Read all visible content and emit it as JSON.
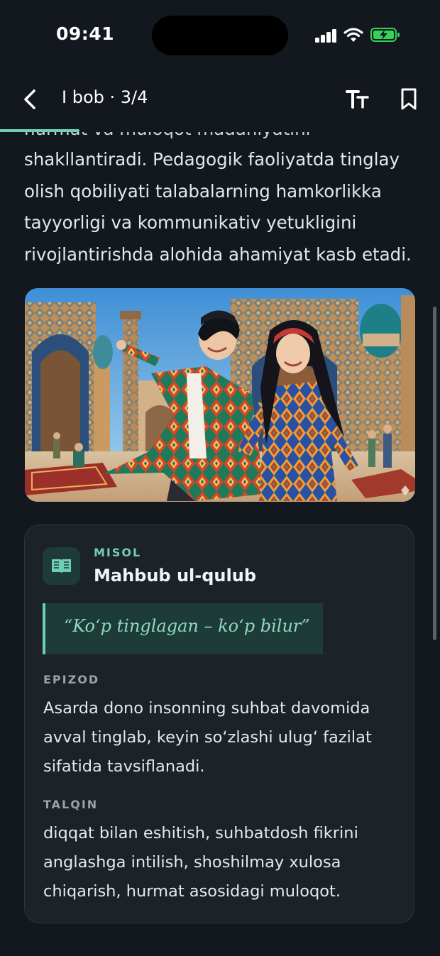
{
  "status_bar": {
    "time": "09:41"
  },
  "header": {
    "chapter": "I bob · 3/4",
    "reading_progress_percent": 18
  },
  "article": {
    "cut_line": "hurmat va muloqot madaniyatini",
    "paragraph": "shakllantiradi. Pedagogik faoliyatda tinglay olish qobiliyati talabalarning hamkorlikka tayyorligi va kommunikativ yetukligini rivojlantirishda alohida ahamiyat kasb etadi."
  },
  "example_card": {
    "kicker": "MISOL",
    "title": "Mahbub ul-qulub",
    "quote": "“Ko‘p tinglagan – ko‘p bilur”",
    "episode_label": "EPIZOD",
    "episode_text": "Asarda dono insonning suhbat davomida avval tinglab, keyin so‘zlashi ulug‘ fazilat sifatida tavsiflanadi.",
    "interpretation_label": "TALQIN",
    "interpretation_text": "diqqat bilan eshitish, suhbatdosh fikrini anglashga intilish, shoshilmay xulosa chiqarish, hurmat asosidagi muloqot."
  },
  "colors": {
    "background": "#12181d",
    "accent": "#6fcdb4",
    "card": "#1b2329",
    "battery_green": "#35d158"
  },
  "icons": [
    "back-chevron-icon",
    "text-size-icon",
    "bookmark-icon",
    "book-icon",
    "signal-icon",
    "wifi-icon",
    "battery-charging-icon"
  ]
}
